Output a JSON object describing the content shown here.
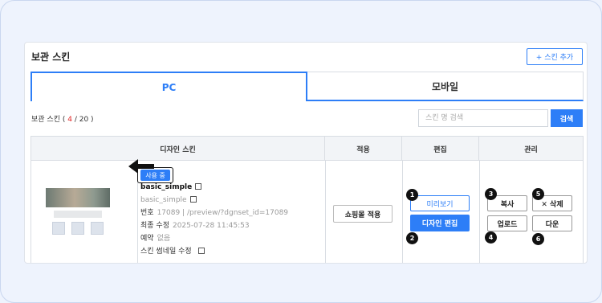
{
  "panel": {
    "title": "보관 스킨",
    "add_button": "+ 스킨 추가"
  },
  "tabs": [
    {
      "label": "PC",
      "active": true
    },
    {
      "label": "모바일",
      "active": false
    }
  ],
  "count": {
    "prefix": "보관 스킨 ( ",
    "current": "4",
    "sep": " / ",
    "total": "20",
    "suffix": " )"
  },
  "search": {
    "placeholder": "스킨 명 검색",
    "button": "검색"
  },
  "table": {
    "headers": [
      "디자인 스킨",
      "적용",
      "편집",
      "관리"
    ],
    "row": {
      "badge": "사용 중",
      "skin_name": "basic_simple",
      "skin_id": "basic_simple",
      "number_label": "번호",
      "number_value": "17089 | /preview/?dgnset_id=17089",
      "modified_label": "최종 수정",
      "modified_value": "2025-07-28 11:45:53",
      "reserve_label": "예약",
      "reserve_value": "없음",
      "thumbnail_edit": "스킨 썸네일 수정",
      "apply_button": "쇼핑몰 적용",
      "preview_button": "미리보기",
      "design_edit_button": "디자인 편집",
      "copy_button": "복사",
      "delete_button": "✕ 삭제",
      "upload_button": "업로드",
      "download_button": "다운"
    }
  },
  "markers": [
    "1",
    "2",
    "3",
    "4",
    "5",
    "6"
  ],
  "colors": {
    "accent": "#2d7ef7",
    "count_red": "#e02020",
    "marker": "#111111"
  }
}
